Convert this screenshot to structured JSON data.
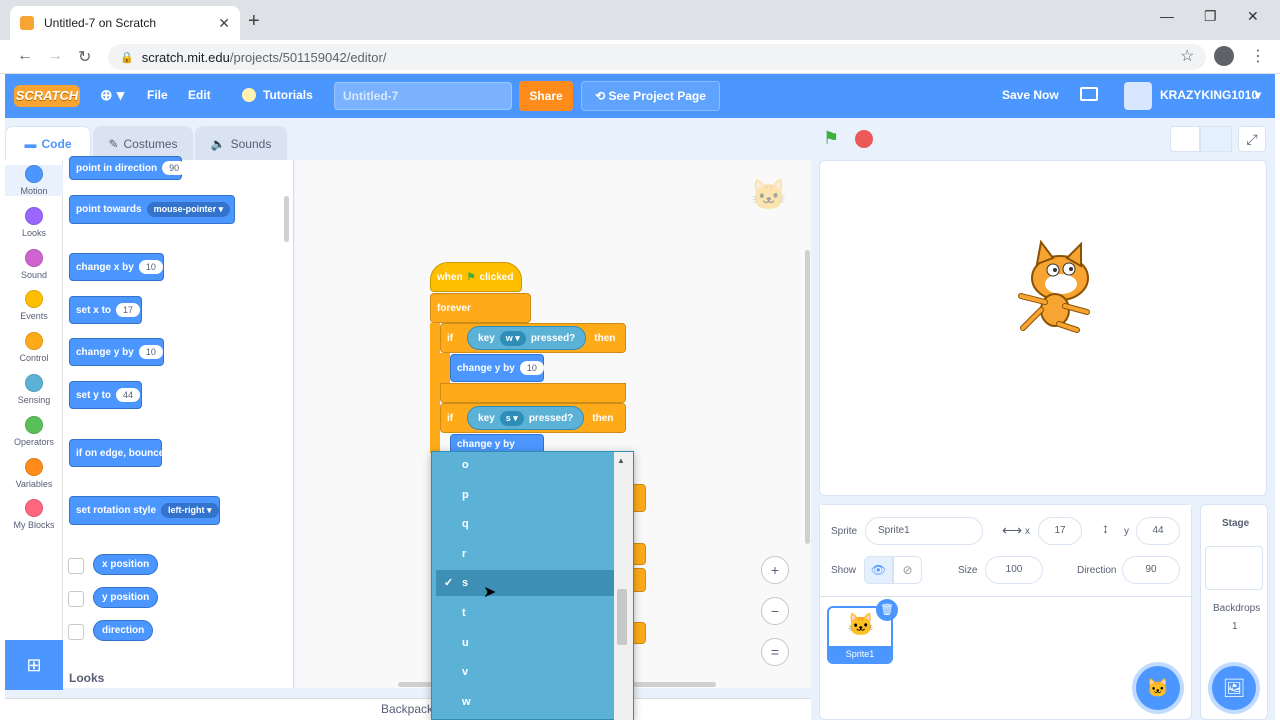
{
  "browser": {
    "tab_title": "Untitled-7 on Scratch",
    "tab_close": "✕",
    "new_tab": "+",
    "url_host": "scratch.mit.edu",
    "url_path": "/projects/501159042/editor/",
    "back": "←",
    "forward": "→",
    "reload": "↻",
    "minimize": "—",
    "maximize": "❐",
    "close": "✕",
    "star": "☆",
    "menu": "⋮"
  },
  "menubar": {
    "logo": "SCRATCH",
    "language": "⊕ ▾",
    "file": "File",
    "edit": "Edit",
    "tutorials": "Tutorials",
    "project_title": "Untitled-7",
    "share": "Share",
    "see_project": "See Project Page",
    "save_now": "Save Now",
    "username": "KRAZYKING1010",
    "user_caret": "▾"
  },
  "tabs": {
    "code": "Code",
    "costumes": "Costumes",
    "sounds": "Sounds"
  },
  "categories": [
    {
      "label": "Motion",
      "color": "#4c97ff"
    },
    {
      "label": "Looks",
      "color": "#9966ff"
    },
    {
      "label": "Sound",
      "color": "#cf63cf"
    },
    {
      "label": "Events",
      "color": "#ffbf00"
    },
    {
      "label": "Control",
      "color": "#ffab19"
    },
    {
      "label": "Sensing",
      "color": "#5cb1d6"
    },
    {
      "label": "Operators",
      "color": "#59c059"
    },
    {
      "label": "Variables",
      "color": "#ff8c1a"
    },
    {
      "label": "My Blocks",
      "color": "#ff6680"
    }
  ],
  "palette": {
    "point_in_direction": "point in direction",
    "point_in_direction_val": "90",
    "point_towards": "point towards",
    "point_towards_val": "mouse-pointer ▾",
    "change_x": "change x by",
    "change_x_val": "10",
    "set_x": "set x to",
    "set_x_val": "17",
    "change_y": "change y by",
    "change_y_val": "10",
    "set_y": "set y to",
    "set_y_val": "44",
    "bounce": "if on edge, bounce",
    "rotation": "set rotation style",
    "rotation_val": "left-right ▾",
    "x_position": "x position",
    "y_position": "y position",
    "direction": "direction",
    "looks_title": "Looks"
  },
  "script": {
    "when": "when",
    "clicked": "clicked",
    "forever": "forever",
    "if1": "if",
    "key1": "key",
    "key1_val": "w ▾",
    "pressed1": "pressed?",
    "then1": "then",
    "change_y1": "change y by",
    "change_y1_val": "10",
    "if2": "if",
    "key2": "key",
    "key2_val": "s ▾",
    "pressed2": "pressed?",
    "then2": "then",
    "change_y2": "change y by"
  },
  "dropdown": {
    "items": [
      "o",
      "p",
      "q",
      "r",
      "s",
      "t",
      "u",
      "v",
      "w"
    ],
    "selected": "s",
    "check": "✓"
  },
  "backpack": "Backpack",
  "zoom": {
    "in": "+",
    "out": "−",
    "reset": "="
  },
  "sprite_info": {
    "sprite_label": "Sprite",
    "sprite_name": "Sprite1",
    "x_label": "x",
    "x_val": "17",
    "y_label": "y",
    "y_val": "44",
    "show_label": "Show",
    "size_label": "Size",
    "size_val": "100",
    "direction_label": "Direction",
    "direction_val": "90"
  },
  "sprite_list": {
    "sprite1": "Sprite1"
  },
  "stage_panel": {
    "title": "Stage",
    "backdrops_label": "Backdrops",
    "backdrops_count": "1"
  }
}
